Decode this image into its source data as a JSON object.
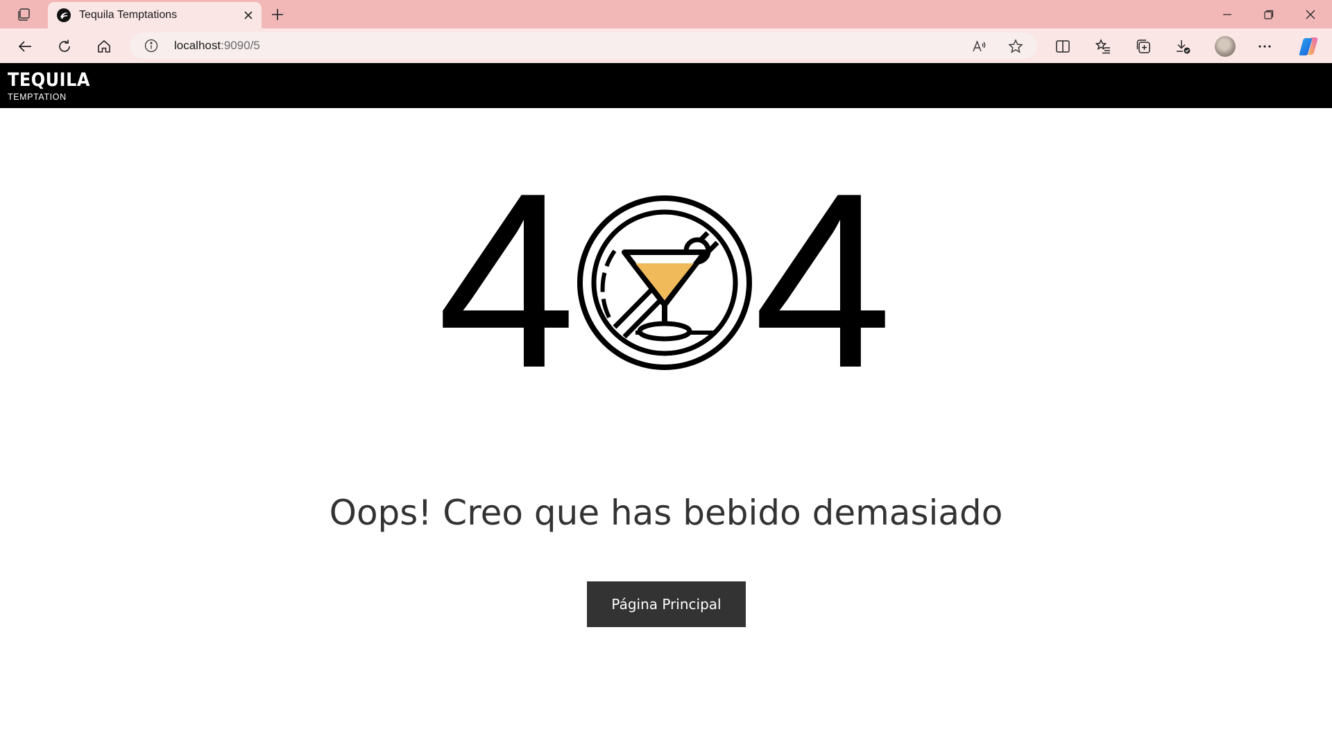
{
  "browser": {
    "tab_title": "Tequila Temptations",
    "url_host": "localhost",
    "url_rest": ":9090/5"
  },
  "site": {
    "logo_main": "TEQUILA",
    "logo_sub": "TEMPTATION"
  },
  "error": {
    "digit_left": "4",
    "digit_right": "4",
    "message": "Oops! Creo que has bebido demasiado",
    "button_label": "Página Principal"
  },
  "colors": {
    "tab_bar": "#f2b8b8",
    "toolbar": "#fbe6e6",
    "header": "#000000",
    "cocktail_liquid": "#f0b95a",
    "button": "#333333",
    "message_text": "#333333"
  },
  "icons": {
    "center_zero": "no-drinking-icon"
  }
}
